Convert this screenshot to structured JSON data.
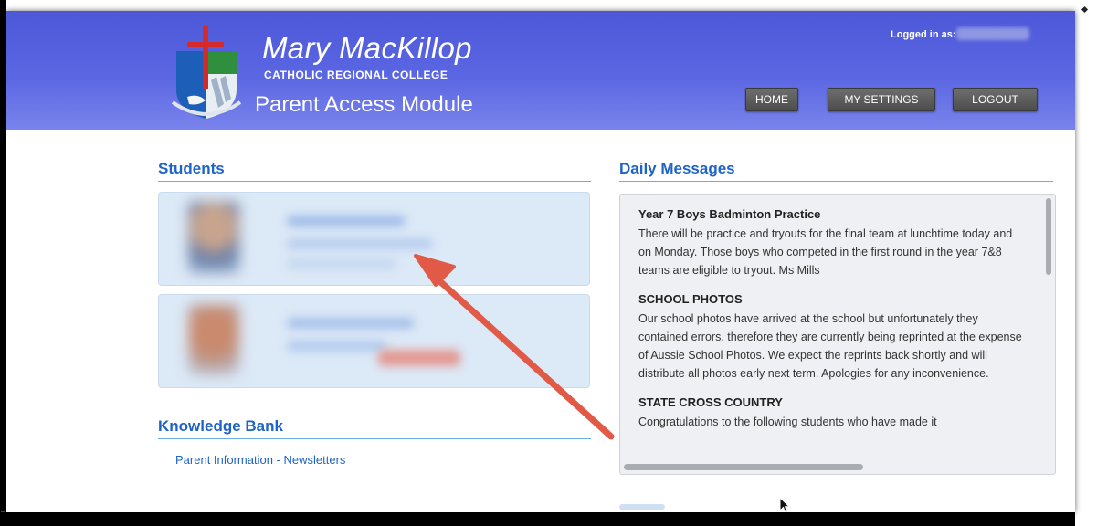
{
  "header": {
    "school_name": "Mary MacKillop",
    "school_subtitle": "CATHOLIC REGIONAL COLLEGE",
    "module_title": "Parent Access Module",
    "logged_in_label": "Logged in as:",
    "nav": {
      "home": "HOME",
      "settings": "MY SETTINGS",
      "logout": "LOGOUT"
    }
  },
  "students": {
    "title": "Students"
  },
  "knowledge_bank": {
    "title": "Knowledge Bank",
    "links": [
      "Parent Information - Newsletters"
    ]
  },
  "daily_messages": {
    "title": "Daily Messages",
    "messages": [
      {
        "title": "Year 7 Boys Badminton Practice",
        "body": "There will be practice and tryouts for the final team at lunchtime today and on Monday. Those boys who competed in the first round in the year 7&8 teams are eligible to tryout. Ms Mills"
      },
      {
        "title": "SCHOOL PHOTOS",
        "body": "Our school photos have arrived at the school but unfortunately they contained errors, therefore they are currently being reprinted at the expense of Aussie School Photos. We expect the reprints back shortly and will distribute all photos early next term. Apologies for any inconvenience."
      },
      {
        "title": "STATE CROSS COUNTRY",
        "body": "Congratulations to the following students who have made it"
      }
    ]
  },
  "colors": {
    "header": "#4c58d8",
    "accent": "#1e63c8",
    "annotation_arrow": "#e05a47"
  },
  "icons": {
    "crest": "school-crest-icon",
    "cursor": "mouse-cursor-icon",
    "annotation": "red-arrow-annotation"
  }
}
